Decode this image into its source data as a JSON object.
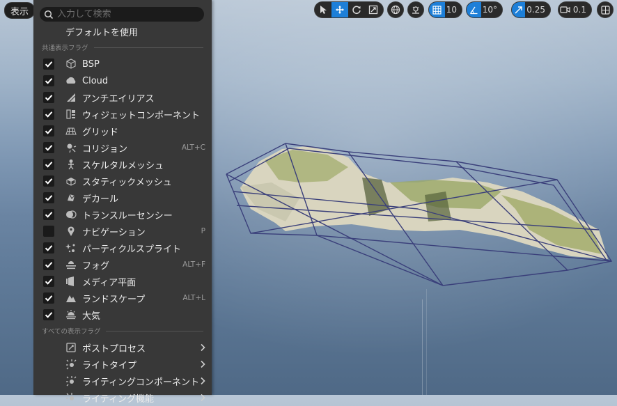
{
  "view_button": {
    "label": "表示"
  },
  "toolbar": {
    "grid_snap_value": "10",
    "rotation_snap_value": "10°",
    "scale_snap_value": "0.25",
    "camera_speed_value": "0.1"
  },
  "menu": {
    "search_placeholder": "入力して検索",
    "default_item": "デフォルトを使用",
    "section_common": "共通表示フラグ",
    "section_all": "すべての表示フラグ",
    "common_flags": [
      {
        "label": "BSP",
        "checked": true,
        "icon": "cube-icon",
        "shortcut": ""
      },
      {
        "label": "Cloud",
        "checked": true,
        "icon": "cloud-icon",
        "shortcut": ""
      },
      {
        "label": "アンチエイリアス",
        "checked": true,
        "icon": "antialias-icon",
        "shortcut": ""
      },
      {
        "label": "ウィジェットコンポーネント",
        "checked": true,
        "icon": "widget-icon",
        "shortcut": ""
      },
      {
        "label": "グリッド",
        "checked": true,
        "icon": "grid-icon",
        "shortcut": ""
      },
      {
        "label": "コリジョン",
        "checked": true,
        "icon": "collision-icon",
        "shortcut": "ALT+C"
      },
      {
        "label": "スケルタルメッシュ",
        "checked": true,
        "icon": "skeleton-icon",
        "shortcut": ""
      },
      {
        "label": "スタティックメッシュ",
        "checked": true,
        "icon": "static-mesh-icon",
        "shortcut": ""
      },
      {
        "label": "デカール",
        "checked": true,
        "icon": "decal-icon",
        "shortcut": ""
      },
      {
        "label": "トランスルーセンシー",
        "checked": true,
        "icon": "translucency-icon",
        "shortcut": ""
      },
      {
        "label": "ナビゲーション",
        "checked": false,
        "icon": "navigation-pin-icon",
        "shortcut": "P"
      },
      {
        "label": "パーティクルスプライト",
        "checked": true,
        "icon": "particle-icon",
        "shortcut": ""
      },
      {
        "label": "フォグ",
        "checked": true,
        "icon": "fog-icon",
        "shortcut": "ALT+F"
      },
      {
        "label": "メディア平面",
        "checked": true,
        "icon": "media-plane-icon",
        "shortcut": ""
      },
      {
        "label": "ランドスケープ",
        "checked": true,
        "icon": "landscape-icon",
        "shortcut": "ALT+L"
      },
      {
        "label": "大気",
        "checked": true,
        "icon": "atmosphere-icon",
        "shortcut": ""
      }
    ],
    "all_flags": [
      {
        "label": "ポストプロセス",
        "icon": "post-process-icon"
      },
      {
        "label": "ライトタイプ",
        "icon": "light-type-icon"
      },
      {
        "label": "ライティングコンポーネント",
        "icon": "lighting-component-icon"
      },
      {
        "label": "ライティング機能",
        "icon": "lighting-feature-icon"
      }
    ]
  },
  "colors": {
    "accent": "#1d7fd8",
    "menu_bg": "#383838",
    "wireframe": "#3a3f7a"
  }
}
